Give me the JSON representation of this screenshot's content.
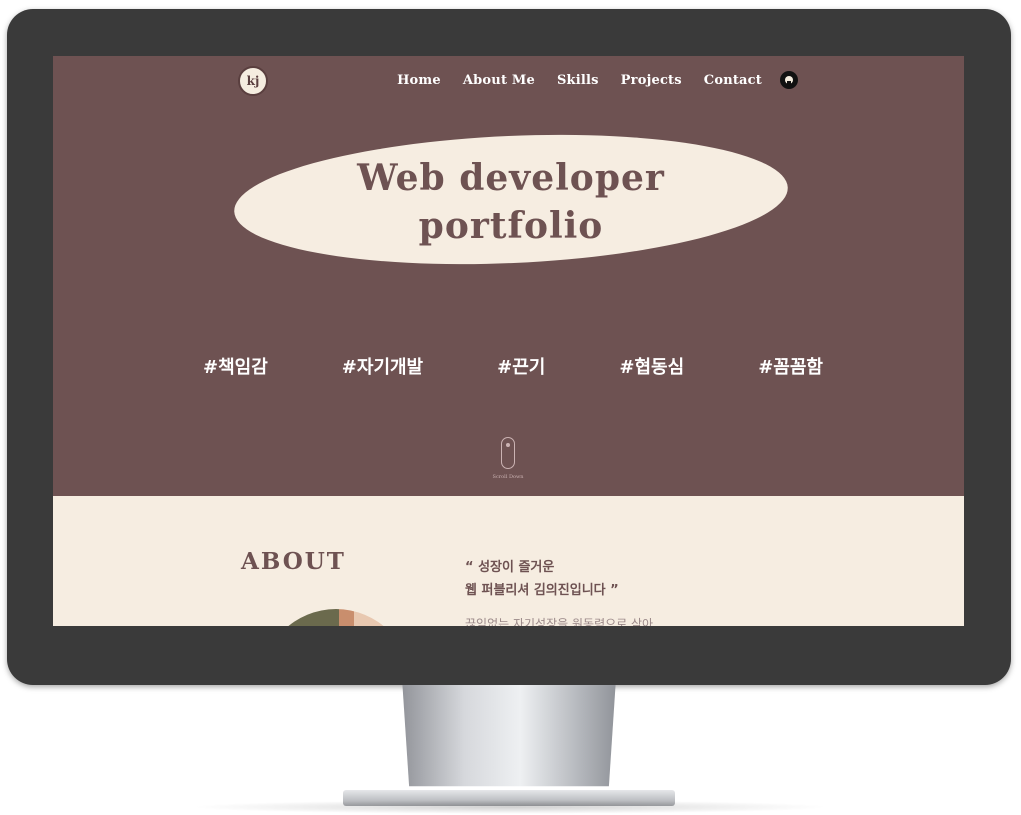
{
  "nav": {
    "logo_text": "kj",
    "links": [
      "Home",
      "About Me",
      "Skills",
      "Projects",
      "Contact"
    ],
    "github_icon": "github-icon"
  },
  "hero": {
    "title_line1": "Web developer",
    "title_line2": "portfolio",
    "tags": [
      "#책임감",
      "#자기개발",
      "#끈기",
      "#협동심",
      "#꼼꼼함"
    ],
    "scroll_text": "Scroll Down"
  },
  "about": {
    "heading": "ABOUT",
    "quote_line1": "“ 성장이 즐거운",
    "quote_line2": "웹 퍼블리셔 김의진입니다 ”",
    "body_text": "끊임없는 자기성장을 원동력으로 삼아"
  },
  "colors": {
    "hero_bg": "#6e5252",
    "cream": "#f6ede1",
    "bezel": "#3a3a3a"
  }
}
